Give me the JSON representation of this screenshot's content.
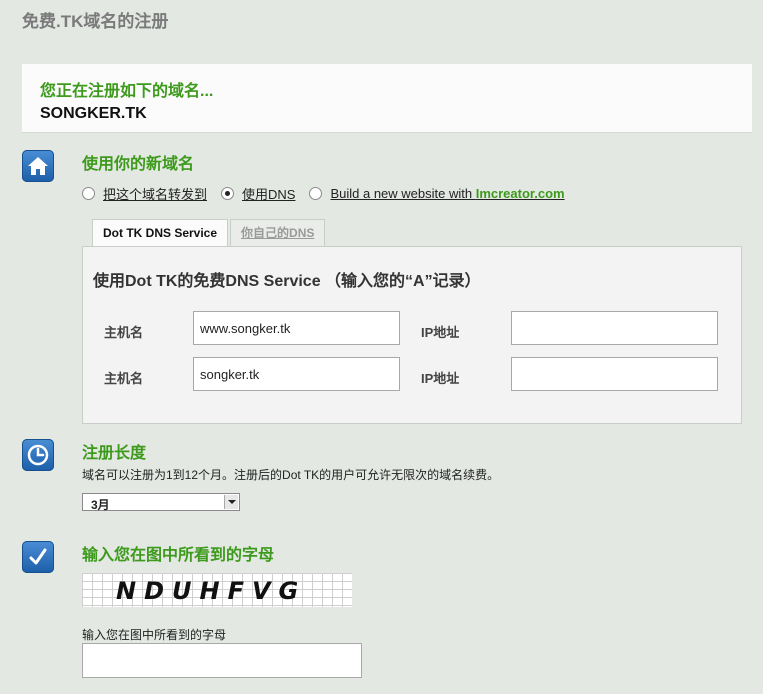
{
  "page": {
    "title": "免费.TK域名的注册"
  },
  "domain_box": {
    "intro": "您正在注册如下的域名...",
    "domain": "SONGKER.TK"
  },
  "use_domain": {
    "title": "使用你的新域名",
    "options": [
      {
        "label": "把这个域名转发到",
        "checked": false
      },
      {
        "label": "使用DNS",
        "checked": true
      },
      {
        "label": "Build a new website with ",
        "brand": "Imcreator.com",
        "checked": false
      }
    ],
    "tabs": [
      {
        "label": "Dot TK DNS Service",
        "active": true
      },
      {
        "label": "你自己的DNS",
        "active": false
      }
    ],
    "panel_title": "使用Dot TK的免费DNS Service （输入您的“A”记录）",
    "rows": [
      {
        "host_label": "主机名",
        "host_value": "www.songker.tk",
        "ip_label": "IP地址",
        "ip_value": ""
      },
      {
        "host_label": "主机名",
        "host_value": "songker.tk",
        "ip_label": "IP地址",
        "ip_value": ""
      }
    ]
  },
  "registration": {
    "title": "注册长度",
    "description": "域名可以注册为1到12个月。注册后的Dot TK的用户可允许无限次的域名续费。",
    "selected": "3月"
  },
  "captcha": {
    "title": "输入您在图中所看到的字母",
    "image_text": "NDUHFVG",
    "input_label": "输入您在图中所看到的字母",
    "input_value": ""
  },
  "colors": {
    "accent_green": "#3d9a1c",
    "icon_blue": "#2a6fbf",
    "background": "#e3e8e3"
  },
  "icons": [
    "home-icon",
    "clock-icon",
    "checkmark-icon"
  ]
}
